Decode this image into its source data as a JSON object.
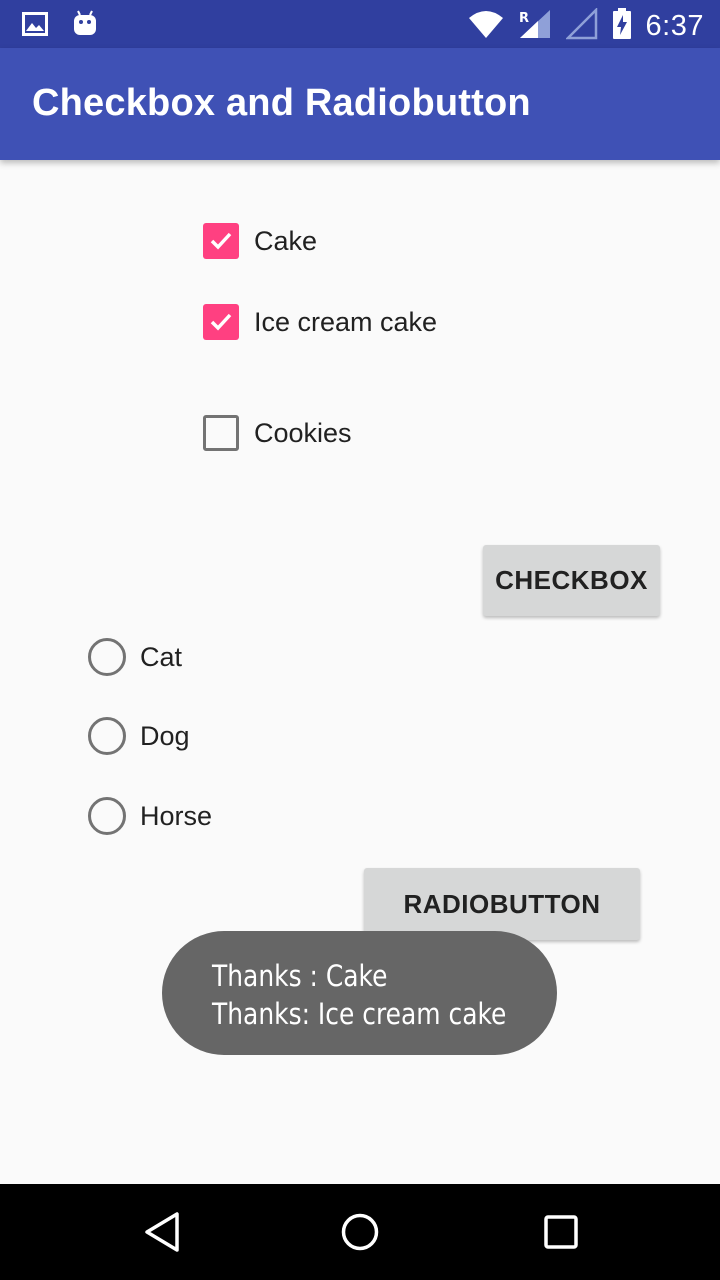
{
  "status_bar": {
    "time": "6:37",
    "icons_left": [
      "image-icon",
      "android-icon"
    ],
    "icons_right": [
      "wifi-icon",
      "signal-roaming-icon",
      "signal-empty-icon",
      "battery-charging-icon"
    ]
  },
  "app_bar": {
    "title": "Checkbox and Radiobutton",
    "color": "#3f51b5",
    "status_color": "#303f9f"
  },
  "checkboxes": [
    {
      "label": "Cake",
      "checked": true
    },
    {
      "label": "Ice cream cake",
      "checked": true
    },
    {
      "label": "Cookies",
      "checked": false
    }
  ],
  "checkbox_button": {
    "label": "CHECKBOX"
  },
  "radio_buttons": [
    {
      "label": "Cat",
      "selected": false
    },
    {
      "label": "Dog",
      "selected": false
    },
    {
      "label": "Horse",
      "selected": false
    }
  ],
  "radio_button_button": {
    "label": "RADIOBUTTON"
  },
  "toast": {
    "lines": [
      "Thanks : Cake",
      "Thanks: Ice cream cake"
    ]
  },
  "accent_color": "#ff4081",
  "nav_bar": {
    "buttons": [
      "back-icon",
      "home-icon",
      "recents-icon"
    ]
  }
}
